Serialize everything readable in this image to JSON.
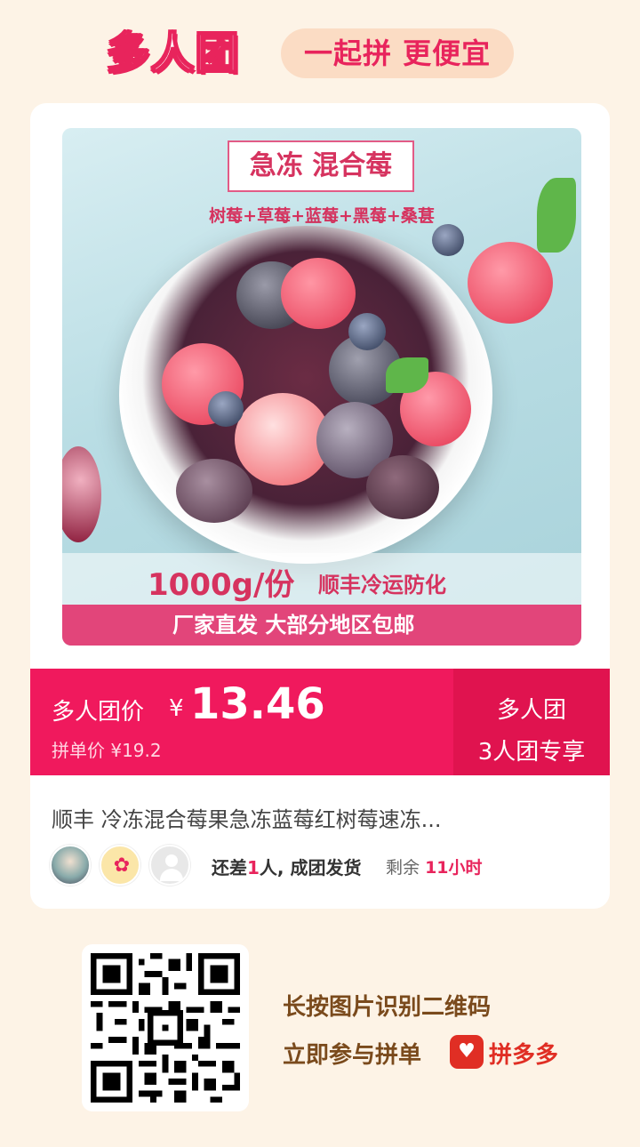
{
  "header": {
    "logo": "多人团",
    "slogan": "一起拼 更便宜"
  },
  "product": {
    "promo_title": "急冻 混合莓",
    "promo_sub": "树莓+草莓+蓝莓+黑莓+桑葚",
    "weight": "1000g/份",
    "cold_chain": "顺丰冷运防化",
    "bar_text": "厂家直发   大部分地区包邮",
    "title": "顺丰 冷冻混合莓果急冻蓝莓红树莓速冻..."
  },
  "price": {
    "label": "多人团价",
    "currency": "¥",
    "value": "13.46",
    "single_price": "拼单价 ¥19.2",
    "group_tag_title": "多人团",
    "group_tag_sub": "3人团专享"
  },
  "group": {
    "need_prefix": "还差",
    "need_count": "1",
    "need_suffix": "人, 成团发货",
    "remain_prefix": "剩余",
    "remain_hours": "11小时"
  },
  "qr": {
    "line1": "长按图片识别二维码",
    "line2": "立即参与拼单",
    "app_name": "拼多多"
  },
  "colors": {
    "accent": "#f0195d",
    "background": "#fdf3e6",
    "brown": "#7a4a1c"
  }
}
